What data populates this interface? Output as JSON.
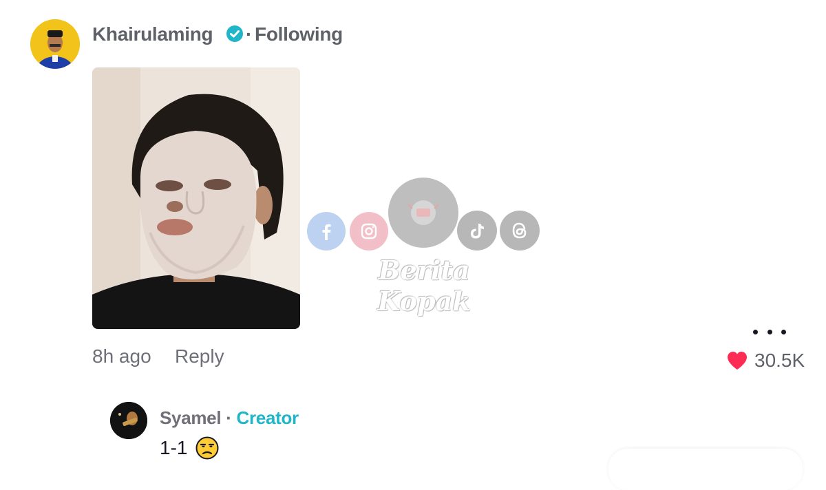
{
  "comment": {
    "username": "Khairulaming",
    "separator": "·",
    "follow_status": "Following",
    "time": "8h ago",
    "reply_label": "Reply",
    "likes": "30.5K"
  },
  "reply": {
    "username": "Syamel",
    "separator": " · ",
    "role_badge": "Creator",
    "text": "1-1",
    "emoji_icon": "unamused-face-icon"
  },
  "watermark": {
    "text": "Berita Kopak",
    "icons": [
      "facebook-icon",
      "instagram-icon",
      "tiktok-icon",
      "threads-icon"
    ]
  },
  "colors": {
    "verified": "#20b5c8",
    "creator": "#20b5c8",
    "like_heart": "#fe2c55"
  }
}
